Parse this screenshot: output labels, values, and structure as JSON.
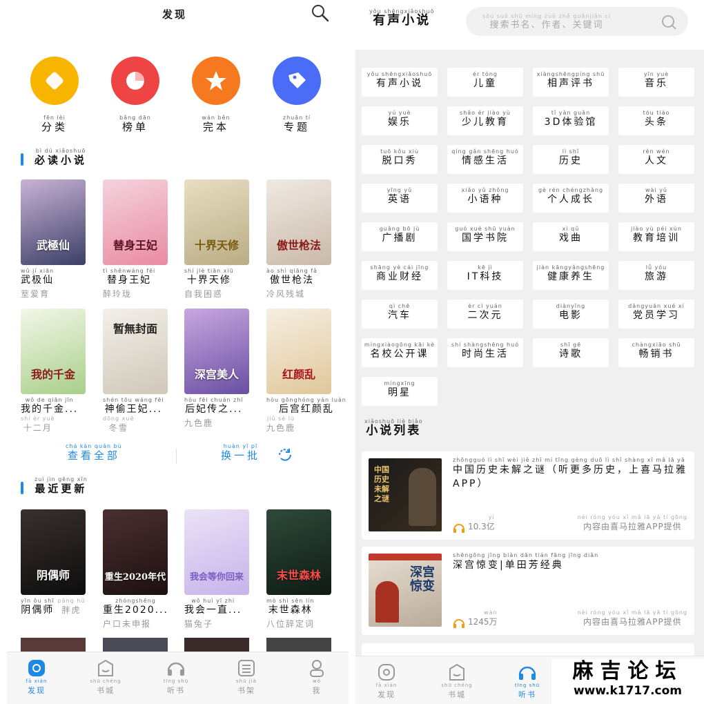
{
  "left": {
    "title": "发现",
    "categories": [
      {
        "py": "fēn lèi",
        "label": "分类",
        "icon": "diamond-icon",
        "color": "#f7b500"
      },
      {
        "py": "bǎng dān",
        "label": "榜单",
        "icon": "chart-ring-icon",
        "color": "#ef4444"
      },
      {
        "py": "wán běn",
        "label": "完本",
        "icon": "star-icon",
        "color": "#f7791f"
      },
      {
        "py": "zhuān tí",
        "label": "专题",
        "icon": "tag-icon",
        "color": "#4a6cf7"
      }
    ],
    "must_read": {
      "py": "bì dú xiǎoshuō",
      "title": "必读小说",
      "books": [
        {
          "name_py": "wǔ jí xiān",
          "name": "武极仙",
          "author_py": "",
          "author": "",
          "cover_text": "武極仙",
          "c1": "#3c3f66",
          "c2": "#c9b3d6"
        },
        {
          "name_py": "tì shēnwáng fēi",
          "name": "替身王妃",
          "author_py": "",
          "author": "醉玲珑",
          "cover_text": "替身王妃",
          "c1": "#f4d3dc",
          "c2": "#e98aa4"
        },
        {
          "name_py": "shí jiè tiān xiū",
          "name": "十界天修",
          "author_py": "",
          "author": "自我困惑",
          "cover_text": "十界天修",
          "c1": "#e8dec2",
          "c2": "#b9ad85"
        },
        {
          "name_py": "ào shì qiāng fǎ",
          "name": "傲世枪法",
          "author_py": "",
          "author": "冷风残城",
          "cover_text": "傲世枪法",
          "c1": "#f0eae4",
          "c2": "#8b1b1b"
        },
        {
          "name_py": "wǒ de qiān jīn",
          "name": "我的千金...",
          "author_py": "shí èr yuè",
          "author": "十二月",
          "cover_text": "我的千金",
          "c1": "#f3f7e9",
          "c2": "#a8cf8a"
        },
        {
          "name_py": "shén tōu wáng fēi",
          "name": "神偷王妃...",
          "author_py": "dōng xuě",
          "author": "冬雪",
          "cover_text": "暂無封面",
          "c1": "#f3f0ea",
          "c2": "#cfc7b8"
        },
        {
          "name_py": "hòu fēi chuán zhī",
          "name": "后妃传之...",
          "author_py": "",
          "author": "九色鹿",
          "cover_text": "深宫美人",
          "c1": "#c7a8e0",
          "c2": "#6a4fa3"
        },
        {
          "name_py": "hòu gōnghóng yán luàn",
          "name": "后宫红颜乱",
          "author_py": "jiǔ sè lù",
          "author": "九色鹿",
          "cover_text": "红颜乱",
          "c1": "#f6efe2",
          "c2": "#e0c79a"
        }
      ]
    },
    "more": {
      "view_all_py": "chá kàn quán bù",
      "view_all": "查看全部",
      "refresh_py": "huàn yī pī",
      "refresh": "换一批"
    },
    "latest": {
      "py": "zuì jìn gēng xīn",
      "title": "最近更新",
      "books": [
        {
          "name_py": "yīn ǒu shī",
          "name": "阴偶师",
          "author_py": "pàng hǔ",
          "author": "胖虎",
          "cover_text": "阴偶师",
          "c1": "#3a2f2f",
          "c2": "#0d0d0d"
        },
        {
          "name_py": "zhòngshēng",
          "name": "重生2020...",
          "author_py": "",
          "author": "户口未申报",
          "cover_text": "重生2020年代",
          "c1": "#4a3030",
          "c2": "#1d1010"
        },
        {
          "name_py": "wǒ huì yī zhí",
          "name": "我会一直...",
          "author_py": "",
          "author": "猫兔子",
          "cover_text": "我会等你回来",
          "c1": "#ebe2f6",
          "c2": "#c6b3ea"
        },
        {
          "name_py": "mò shì sēn lín",
          "name": "末世森林",
          "author_py": "",
          "author": "八位辞定词",
          "cover_text": "末世森林",
          "c1": "#2e4a3a",
          "c2": "#0f1a14"
        }
      ]
    }
  },
  "tabs": [
    {
      "py": "fā xiàn",
      "label": "发现",
      "icon": "discover-icon"
    },
    {
      "py": "shū chéng",
      "label": "书城",
      "icon": "bookstore-icon"
    },
    {
      "py": "tīng shū",
      "label": "听书",
      "icon": "headphones-icon"
    },
    {
      "py": "shū jià",
      "label": "书架",
      "icon": "bookshelf-icon"
    },
    {
      "py": "wǒ",
      "label": "我",
      "icon": "profile-icon"
    }
  ],
  "right": {
    "title_py": "yǒu shēngxiǎoshuō",
    "title": "有声小说",
    "search_py": "sōu suǒ shū míng   zuò zhě   guānjiàn cí",
    "search_placeholder": "搜索书名、作者、关键词",
    "categories": [
      {
        "py": "yǒu shēngxiǎoshuō",
        "label": "有声小说"
      },
      {
        "py": "ér tóng",
        "label": "儿童"
      },
      {
        "py": "xiàngshēngpíng shū",
        "label": "相声评书"
      },
      {
        "py": "yīn yuè",
        "label": "音乐"
      },
      {
        "py": "yú yuè",
        "label": "娱乐"
      },
      {
        "py": "shǎo ér jiào yù",
        "label": "少儿教育"
      },
      {
        "py": "tǐ yàn guǎn",
        "label": "3D体验馆"
      },
      {
        "py": "tóu tiáo",
        "label": "头条"
      },
      {
        "py": "tuō kǒu xiù",
        "label": "脱口秀"
      },
      {
        "py": "qíng gǎn shēng huó",
        "label": "情感生活"
      },
      {
        "py": "lì shǐ",
        "label": "历史"
      },
      {
        "py": "rén wén",
        "label": "人文"
      },
      {
        "py": "yīng yǔ",
        "label": "英语"
      },
      {
        "py": "xiǎo yǔ zhǒng",
        "label": "小语种"
      },
      {
        "py": "gè rén chéngzhǎng",
        "label": "个人成长"
      },
      {
        "py": "wài yǔ",
        "label": "外语"
      },
      {
        "py": "guǎng bō jù",
        "label": "广播剧"
      },
      {
        "py": "guó xué shū yuàn",
        "label": "国学书院"
      },
      {
        "py": "xì qǔ",
        "label": "戏曲"
      },
      {
        "py": "jiào yù péi xùn",
        "label": "教育培训"
      },
      {
        "py": "shāng yè cái jīng",
        "label": "商业财经"
      },
      {
        "py": "kē jì",
        "label": "IT科技"
      },
      {
        "py": "jiàn kāngyǎngshēng",
        "label": "健康养生"
      },
      {
        "py": "lǚ yóu",
        "label": "旅游"
      },
      {
        "py": "qì chē",
        "label": "汽车"
      },
      {
        "py": "èr cì yuán",
        "label": "二次元"
      },
      {
        "py": "diànyǐng",
        "label": "电影"
      },
      {
        "py": "dǎngyuán xué xí",
        "label": "党员学习"
      },
      {
        "py": "míngxiàogōng kāi kè",
        "label": "名校公开课"
      },
      {
        "py": "shí shàngshēng huó",
        "label": "时尚生活"
      },
      {
        "py": "shī gē",
        "label": "诗歌"
      },
      {
        "py": "chàngxiāo shū",
        "label": "畅销书"
      },
      {
        "py": "míngxīng",
        "label": "明星"
      }
    ],
    "list_py": "xiǎoshuō liè biǎo",
    "list_title": "小说列表",
    "items": [
      {
        "title_py": "zhōngguó lì shǐ wèi jiě zhī mí   tīng gèng duō lì shǐ shàng xǐ mǎ lā yǎ",
        "title": "中国历史未解之谜（听更多历史，上喜马拉雅APP）",
        "count_py": "yì",
        "count": "10.3亿",
        "source_py": "nèi róng yóu xǐ mǎ lā yǎ tí gōng",
        "source": "内容由喜马拉雅APP提供",
        "thumb_text": "中国历史未解之谜"
      },
      {
        "title_py": "shēngōng jīng biàn   dān tián fāng jīng diǎn",
        "title": "深宫惊变|单田芳经典",
        "count_py": "wàn",
        "count": "1245万",
        "source_py": "nèi róng yóu xǐ mǎ lā yǎ tí gōng",
        "source": "内容由喜马拉雅APP提供",
        "thumb_text": "深宫惊变"
      }
    ]
  },
  "watermark": {
    "big": "麻吉论坛",
    "url": "www.k1717.com"
  },
  "colors": {
    "accent": "#1e88e5",
    "headphone_orange": "#f39c12"
  }
}
